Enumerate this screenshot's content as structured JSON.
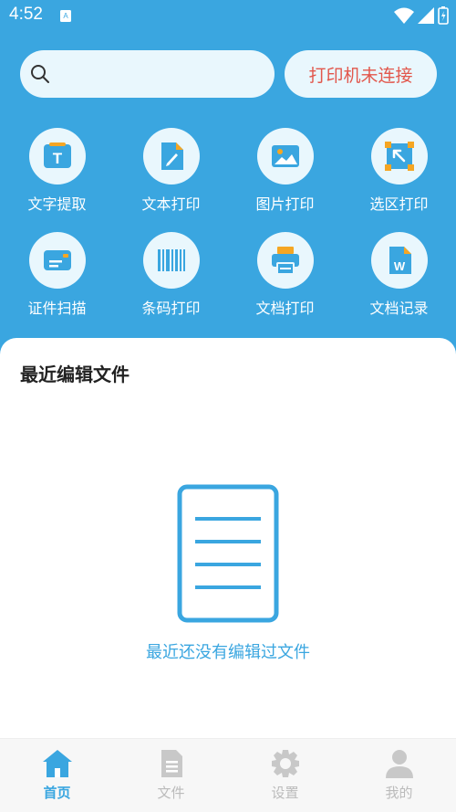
{
  "status_bar": {
    "time": "4:52"
  },
  "search": {
    "placeholder": ""
  },
  "printer_status": "打印机未连接",
  "tools": [
    {
      "label": "文字提取",
      "icon": "text-extract-icon"
    },
    {
      "label": "文本打印",
      "icon": "text-print-icon"
    },
    {
      "label": "图片打印",
      "icon": "image-print-icon"
    },
    {
      "label": "选区打印",
      "icon": "selection-print-icon"
    },
    {
      "label": "证件扫描",
      "icon": "id-scan-icon"
    },
    {
      "label": "条码打印",
      "icon": "barcode-icon"
    },
    {
      "label": "文档打印",
      "icon": "printer-icon"
    },
    {
      "label": "文档记录",
      "icon": "word-doc-icon"
    }
  ],
  "recent": {
    "title": "最近编辑文件",
    "empty_text": "最近还没有编辑过文件"
  },
  "tabs": [
    {
      "label": "首页",
      "icon": "home-icon",
      "active": true
    },
    {
      "label": "文件",
      "icon": "file-icon",
      "active": false
    },
    {
      "label": "设置",
      "icon": "settings-icon",
      "active": false
    },
    {
      "label": "我的",
      "icon": "profile-icon",
      "active": false
    }
  ],
  "colors": {
    "accent": "#3aa6e0",
    "warning": "#e2574c",
    "tile_bg": "#e9f7fd"
  }
}
